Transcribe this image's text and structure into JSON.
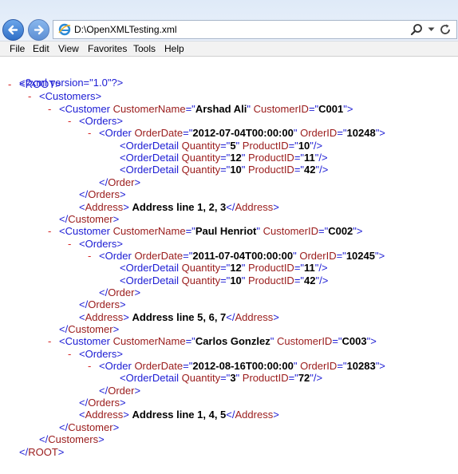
{
  "browser": {
    "address": "D:\\OpenXMLTesting.xml",
    "menu": [
      "File",
      "Edit",
      "View",
      "Favorites",
      "Tools",
      "Help"
    ]
  },
  "xml": {
    "declaration": "<?xml version=\"1.0\"?>",
    "lines": [
      {
        "minus": true,
        "parts": [
          [
            "tg",
            "<ROOT>"
          ]
        ]
      },
      {
        "minus": true,
        "parts": [
          [
            "tg",
            "<Customers>"
          ]
        ]
      },
      {
        "minus": true,
        "parts": [
          [
            "tg",
            "<Customer "
          ],
          [
            "an",
            "CustomerName"
          ],
          [
            "tg",
            "=\""
          ],
          [
            "av",
            "Arshad Ali"
          ],
          [
            "tg",
            "\" "
          ],
          [
            "an",
            "CustomerID"
          ],
          [
            "tg",
            "=\""
          ],
          [
            "av",
            "C001"
          ],
          [
            "tg",
            "\">"
          ]
        ]
      },
      {
        "minus": true,
        "parts": [
          [
            "tg",
            "<Orders>"
          ]
        ]
      },
      {
        "minus": true,
        "parts": [
          [
            "tg",
            "<Order "
          ],
          [
            "an",
            "OrderDate"
          ],
          [
            "tg",
            "=\""
          ],
          [
            "av",
            "2012-07-04T00:00:00"
          ],
          [
            "tg",
            "\" "
          ],
          [
            "an",
            "OrderID"
          ],
          [
            "tg",
            "=\""
          ],
          [
            "av",
            "10248"
          ],
          [
            "tg",
            "\">"
          ]
        ]
      },
      {
        "minus": false,
        "parts": [
          [
            "tg",
            "<OrderDetail "
          ],
          [
            "an",
            "Quantity"
          ],
          [
            "tg",
            "=\""
          ],
          [
            "av",
            "5"
          ],
          [
            "tg",
            "\" "
          ],
          [
            "an",
            "ProductID"
          ],
          [
            "tg",
            "=\""
          ],
          [
            "av",
            "10"
          ],
          [
            "tg",
            "\"/>"
          ]
        ]
      },
      {
        "minus": false,
        "parts": [
          [
            "tg",
            "<OrderDetail "
          ],
          [
            "an",
            "Quantity"
          ],
          [
            "tg",
            "=\""
          ],
          [
            "av",
            "12"
          ],
          [
            "tg",
            "\" "
          ],
          [
            "an",
            "ProductID"
          ],
          [
            "tg",
            "=\""
          ],
          [
            "av",
            "11"
          ],
          [
            "tg",
            "\"/>"
          ]
        ]
      },
      {
        "minus": false,
        "parts": [
          [
            "tg",
            "<OrderDetail "
          ],
          [
            "an",
            "Quantity"
          ],
          [
            "tg",
            "=\""
          ],
          [
            "av",
            "10"
          ],
          [
            "tg",
            "\" "
          ],
          [
            "an",
            "ProductID"
          ],
          [
            "tg",
            "=\""
          ],
          [
            "av",
            "42"
          ],
          [
            "tg",
            "\"/>"
          ]
        ]
      },
      {
        "minus": false,
        "parts": [
          [
            "tg",
            "</"
          ],
          [
            "an",
            "Order"
          ],
          [
            "tg",
            ">"
          ]
        ]
      },
      {
        "minus": false,
        "parts": [
          [
            "tg",
            "</"
          ],
          [
            "an",
            "Orders"
          ],
          [
            "tg",
            ">"
          ]
        ]
      },
      {
        "minus": false,
        "parts": [
          [
            "tg",
            "<"
          ],
          [
            "an",
            "Address"
          ],
          [
            "tg",
            "> "
          ],
          [
            "ct",
            "Address line 1, 2, 3"
          ],
          [
            "tg",
            "</"
          ],
          [
            "an",
            "Address"
          ],
          [
            "tg",
            ">"
          ]
        ]
      },
      {
        "minus": false,
        "parts": [
          [
            "tg",
            "</"
          ],
          [
            "an",
            "Customer"
          ],
          [
            "tg",
            ">"
          ]
        ]
      },
      {
        "minus": true,
        "parts": [
          [
            "tg",
            "<Customer "
          ],
          [
            "an",
            "CustomerName"
          ],
          [
            "tg",
            "=\""
          ],
          [
            "av",
            "Paul Henriot"
          ],
          [
            "tg",
            "\" "
          ],
          [
            "an",
            "CustomerID"
          ],
          [
            "tg",
            "=\""
          ],
          [
            "av",
            "C002"
          ],
          [
            "tg",
            "\">"
          ]
        ]
      },
      {
        "minus": true,
        "parts": [
          [
            "tg",
            "<Orders>"
          ]
        ]
      },
      {
        "minus": true,
        "parts": [
          [
            "tg",
            "<Order "
          ],
          [
            "an",
            "OrderDate"
          ],
          [
            "tg",
            "=\""
          ],
          [
            "av",
            "2011-07-04T00:00:00"
          ],
          [
            "tg",
            "\" "
          ],
          [
            "an",
            "OrderID"
          ],
          [
            "tg",
            "=\""
          ],
          [
            "av",
            "10245"
          ],
          [
            "tg",
            "\">"
          ]
        ]
      },
      {
        "minus": false,
        "parts": [
          [
            "tg",
            "<OrderDetail "
          ],
          [
            "an",
            "Quantity"
          ],
          [
            "tg",
            "=\""
          ],
          [
            "av",
            "12"
          ],
          [
            "tg",
            "\" "
          ],
          [
            "an",
            "ProductID"
          ],
          [
            "tg",
            "=\""
          ],
          [
            "av",
            "11"
          ],
          [
            "tg",
            "\"/>"
          ]
        ]
      },
      {
        "minus": false,
        "parts": [
          [
            "tg",
            "<OrderDetail "
          ],
          [
            "an",
            "Quantity"
          ],
          [
            "tg",
            "=\""
          ],
          [
            "av",
            "10"
          ],
          [
            "tg",
            "\" "
          ],
          [
            "an",
            "ProductID"
          ],
          [
            "tg",
            "=\""
          ],
          [
            "av",
            "42"
          ],
          [
            "tg",
            "\"/>"
          ]
        ]
      },
      {
        "minus": false,
        "parts": [
          [
            "tg",
            "</"
          ],
          [
            "an",
            "Order"
          ],
          [
            "tg",
            ">"
          ]
        ]
      },
      {
        "minus": false,
        "parts": [
          [
            "tg",
            "</"
          ],
          [
            "an",
            "Orders"
          ],
          [
            "tg",
            ">"
          ]
        ]
      },
      {
        "minus": false,
        "parts": [
          [
            "tg",
            "<"
          ],
          [
            "an",
            "Address"
          ],
          [
            "tg",
            "> "
          ],
          [
            "ct",
            "Address line 5, 6, 7"
          ],
          [
            "tg",
            "</"
          ],
          [
            "an",
            "Address"
          ],
          [
            "tg",
            ">"
          ]
        ]
      },
      {
        "minus": false,
        "parts": [
          [
            "tg",
            "</"
          ],
          [
            "an",
            "Customer"
          ],
          [
            "tg",
            ">"
          ]
        ]
      },
      {
        "minus": true,
        "parts": [
          [
            "tg",
            "<Customer "
          ],
          [
            "an",
            "CustomerName"
          ],
          [
            "tg",
            "=\""
          ],
          [
            "av",
            "Carlos Gonzlez"
          ],
          [
            "tg",
            "\" "
          ],
          [
            "an",
            "CustomerID"
          ],
          [
            "tg",
            "=\""
          ],
          [
            "av",
            "C003"
          ],
          [
            "tg",
            "\">"
          ]
        ]
      },
      {
        "minus": true,
        "parts": [
          [
            "tg",
            "<Orders>"
          ]
        ]
      },
      {
        "minus": true,
        "parts": [
          [
            "tg",
            "<Order "
          ],
          [
            "an",
            "OrderDate"
          ],
          [
            "tg",
            "=\""
          ],
          [
            "av",
            "2012-08-16T00:00:00"
          ],
          [
            "tg",
            "\" "
          ],
          [
            "an",
            "OrderID"
          ],
          [
            "tg",
            "=\""
          ],
          [
            "av",
            "10283"
          ],
          [
            "tg",
            "\">"
          ]
        ]
      },
      {
        "minus": false,
        "parts": [
          [
            "tg",
            "<OrderDetail "
          ],
          [
            "an",
            "Quantity"
          ],
          [
            "tg",
            "=\""
          ],
          [
            "av",
            "3"
          ],
          [
            "tg",
            "\" "
          ],
          [
            "an",
            "ProductID"
          ],
          [
            "tg",
            "=\""
          ],
          [
            "av",
            "72"
          ],
          [
            "tg",
            "\"/>"
          ]
        ]
      },
      {
        "minus": false,
        "parts": [
          [
            "tg",
            "</"
          ],
          [
            "an",
            "Order"
          ],
          [
            "tg",
            ">"
          ]
        ]
      },
      {
        "minus": false,
        "parts": [
          [
            "tg",
            "</"
          ],
          [
            "an",
            "Orders"
          ],
          [
            "tg",
            ">"
          ]
        ]
      },
      {
        "minus": false,
        "parts": [
          [
            "tg",
            "<"
          ],
          [
            "an",
            "Address"
          ],
          [
            "tg",
            "> "
          ],
          [
            "ct",
            "Address line 1, 4, 5"
          ],
          [
            "tg",
            "</"
          ],
          [
            "an",
            "Address"
          ],
          [
            "tg",
            ">"
          ]
        ]
      },
      {
        "minus": false,
        "parts": [
          [
            "tg",
            "</"
          ],
          [
            "an",
            "Customer"
          ],
          [
            "tg",
            ">"
          ]
        ]
      },
      {
        "minus": false,
        "parts": [
          [
            "tg",
            "</"
          ],
          [
            "an",
            "Customers"
          ],
          [
            "tg",
            ">"
          ]
        ]
      },
      {
        "minus": false,
        "parts": [
          [
            "tg",
            "</"
          ],
          [
            "an",
            "ROOT"
          ],
          [
            "tg",
            ">"
          ]
        ]
      }
    ]
  }
}
